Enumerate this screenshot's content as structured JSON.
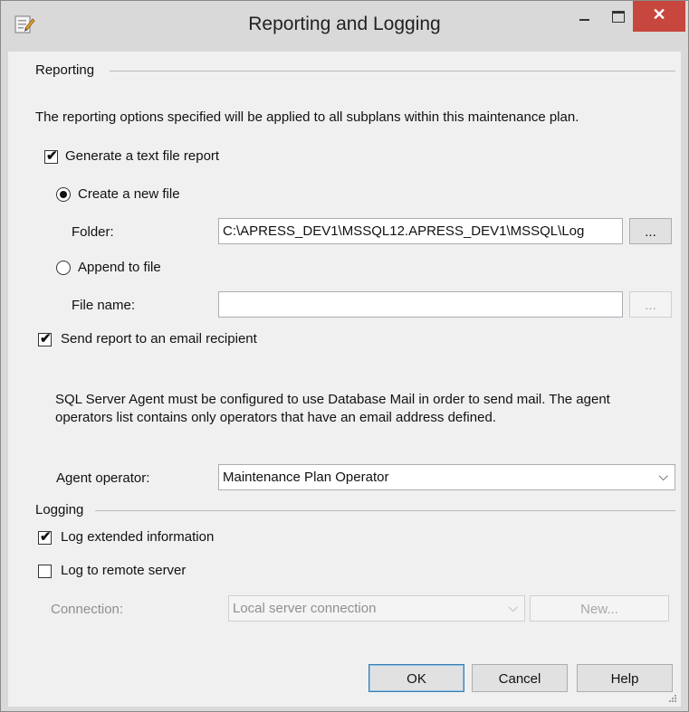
{
  "window": {
    "title": "Reporting and Logging",
    "close_glyph": "✕",
    "icons": [
      "app-icon",
      "minimize-icon",
      "maximize-icon",
      "close-icon"
    ]
  },
  "reporting": {
    "section_label": "Reporting",
    "description": "The reporting options specified will be applied to all subplans within this maintenance plan.",
    "generate_text_report": {
      "label": "Generate a text file report",
      "checked": true
    },
    "create_new_file": {
      "label": "Create a new file",
      "selected": true
    },
    "folder": {
      "label": "Folder:",
      "value": "C:\\APRESS_DEV1\\MSSQL12.APRESS_DEV1\\MSSQL\\Log",
      "browse_label": "..."
    },
    "append_to_file": {
      "label": "Append to file",
      "selected": false
    },
    "file_name": {
      "label": "File name:",
      "value": "",
      "browse_label": "..."
    },
    "send_email": {
      "label": "Send report to an email recipient",
      "checked": true
    },
    "mail_note_line1": "SQL Server Agent must be configured to use Database Mail in order to send mail. The agent",
    "mail_note_line2": "operators list contains only operators that have an email address defined.",
    "agent_operator": {
      "label": "Agent operator:",
      "value": "Maintenance Plan Operator"
    }
  },
  "logging": {
    "section_label": "Logging",
    "log_extended": {
      "label": "Log extended information",
      "checked": true
    },
    "log_remote": {
      "label": "Log to remote server",
      "checked": false
    },
    "connection": {
      "label": "Connection:",
      "value": "Local server connection",
      "new_label": "New..."
    }
  },
  "footer": {
    "ok_label": "OK",
    "cancel_label": "Cancel",
    "help_label": "Help"
  },
  "glyphs": {
    "check": "✔",
    "chevron": "⌵"
  }
}
